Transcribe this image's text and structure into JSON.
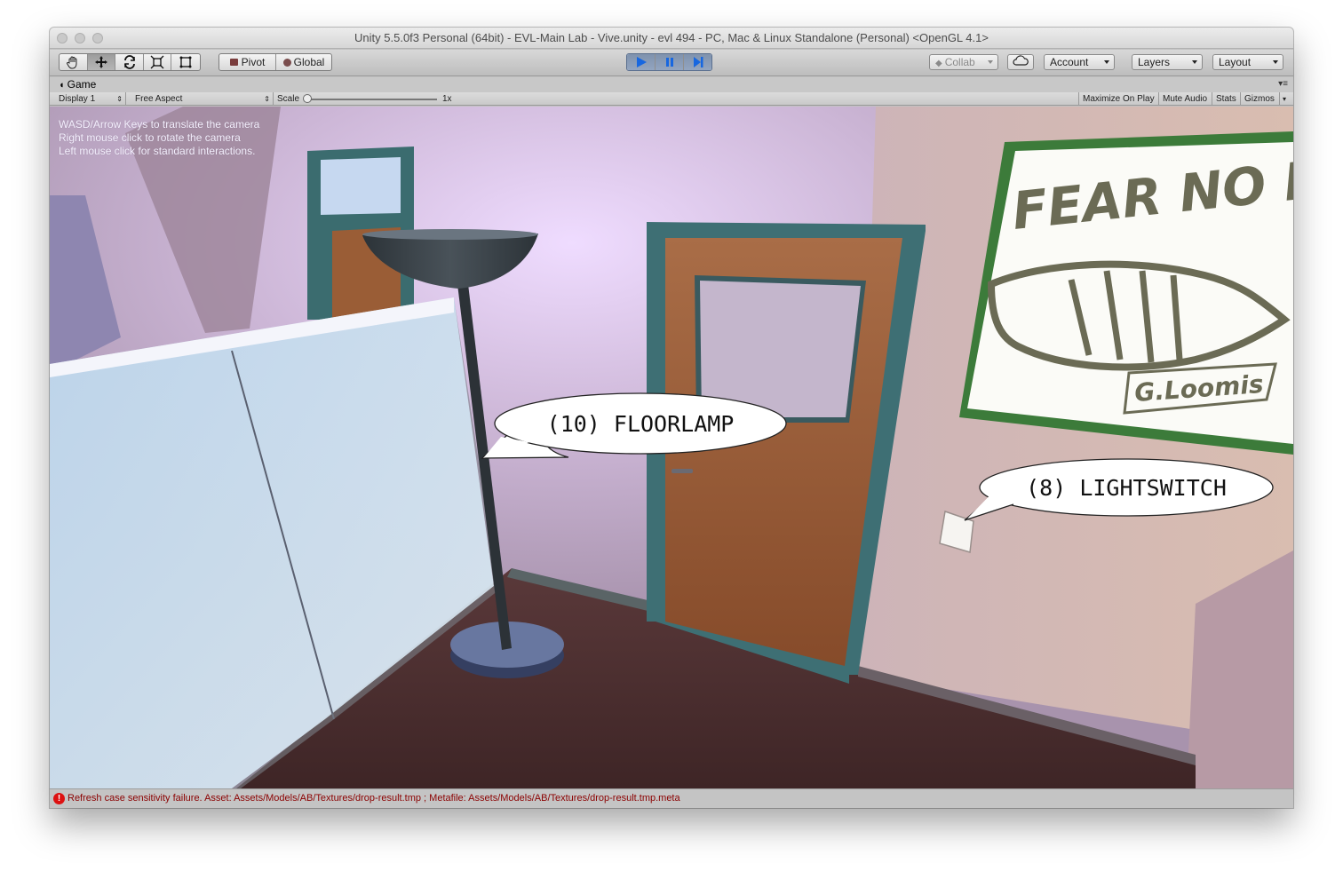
{
  "window": {
    "title": "Unity 5.5.0f3 Personal (64bit) - EVL-Main Lab - Vive.unity - evl 494 - PC, Mac & Linux Standalone (Personal) <OpenGL 4.1>"
  },
  "toolbar": {
    "tools": [
      "hand-icon",
      "move-icon",
      "rotate-icon",
      "scale-icon",
      "rect-icon"
    ],
    "pivot_label": "Pivot",
    "global_label": "Global",
    "playback": [
      "play-icon",
      "pause-icon",
      "step-icon"
    ],
    "collab_label": "Collab",
    "account_label": "Account",
    "layers_label": "Layers",
    "layout_label": "Layout"
  },
  "tab": {
    "label": "Game"
  },
  "gamebar": {
    "display": "Display 1",
    "aspect": "Free Aspect",
    "scale_label": "Scale",
    "scale_value": "1x",
    "maximize": "Maximize On Play",
    "mute": "Mute Audio",
    "stats": "Stats",
    "gizmos": "Gizmos"
  },
  "viewport": {
    "help_lines": [
      "WASD/Arrow Keys to translate the camera",
      "Right mouse click to rotate the camera",
      "Left mouse click for standard interactions."
    ],
    "callout_lamp": "(10) FLOORLAMP",
    "callout_switch": "(8) LIGHTSWITCH",
    "poster_headline": "FEAR NO FIS",
    "poster_brand": "G.Loomis"
  },
  "status": {
    "message": "Refresh case sensitivity failure. Asset: Assets/Models/AB/Textures/drop-result.tmp ; Metafile: Assets/Models/AB/Textures/drop-result.tmp.meta"
  },
  "colors": {
    "wall": "#c9b2c4",
    "door": "#9a5d36",
    "door_frame": "#3e6f74",
    "floor": "#4b3031",
    "glass": "#cfe0ec",
    "lamp": "#2f3a47"
  }
}
